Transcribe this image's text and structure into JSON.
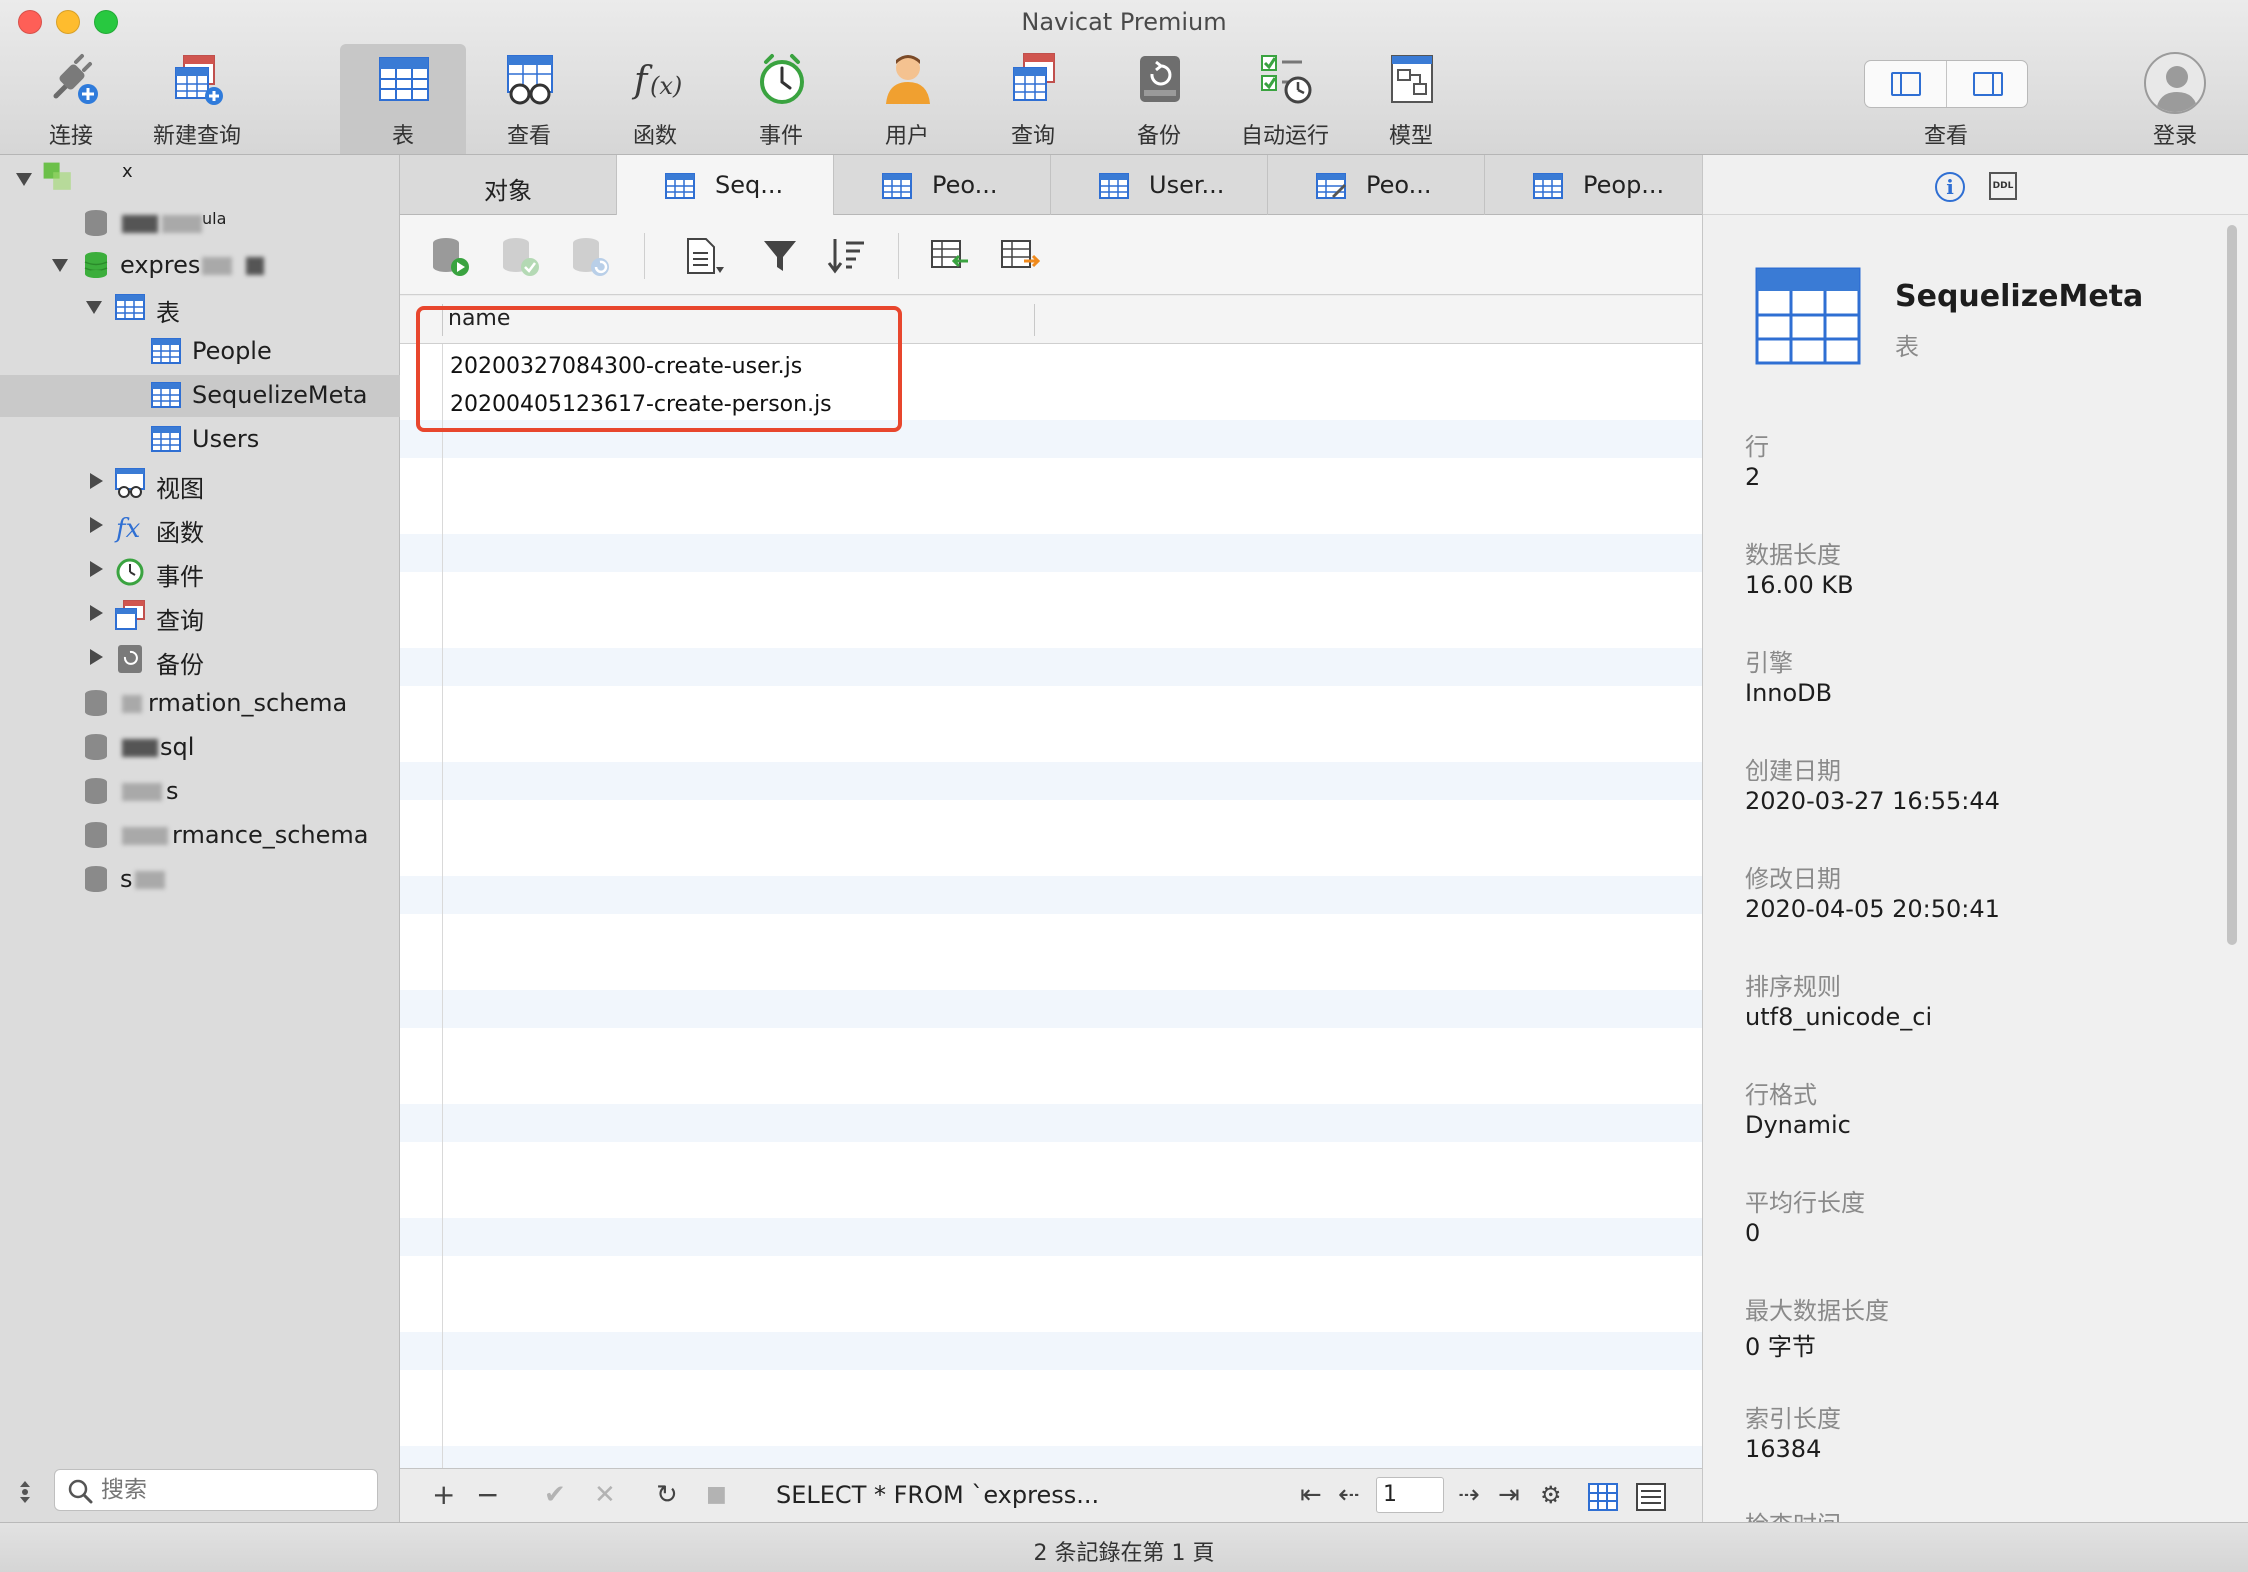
{
  "window": {
    "title": "Navicat Premium"
  },
  "toolbar": {
    "items": [
      {
        "label": "连接",
        "icon": "connection-plug-icon"
      },
      {
        "label": "新建查询",
        "icon": "new-query-icon"
      },
      {
        "label": "表",
        "icon": "table-icon",
        "active": true
      },
      {
        "label": "查看",
        "icon": "view-glasses-icon"
      },
      {
        "label": "函数",
        "icon": "function-fx-icon"
      },
      {
        "label": "事件",
        "icon": "event-clock-icon"
      },
      {
        "label": "用户",
        "icon": "user-icon"
      },
      {
        "label": "查询",
        "icon": "query-icon"
      },
      {
        "label": "备份",
        "icon": "backup-icon"
      },
      {
        "label": "自动运行",
        "icon": "automation-icon"
      },
      {
        "label": "模型",
        "icon": "model-icon"
      }
    ],
    "view_label": "查看",
    "login_label": "登录"
  },
  "sidebar": {
    "connection_suffix": "x",
    "db_first_suffix": "ula",
    "db_express": "expres",
    "tables_group": "表",
    "tables": [
      "People",
      "SequelizeMeta",
      "Users"
    ],
    "groups": [
      "视图",
      "函数",
      "事件",
      "查询",
      "备份"
    ],
    "other_dbs": [
      "rmation_schema",
      "sql",
      "s",
      "rmance_schema",
      "s"
    ],
    "search_placeholder": "搜索"
  },
  "tabs": [
    "对象",
    "Seq...",
    "Peo...",
    "User...",
    "Peo...",
    "Peop..."
  ],
  "grid": {
    "columns": [
      "name"
    ],
    "rows": [
      "20200327084300-create-user.js",
      "20200405123617-create-person.js"
    ]
  },
  "bottom_bar": {
    "add": "+",
    "remove": "−",
    "apply": "✔",
    "discard": "✕",
    "refresh": "↻",
    "stop": "■",
    "sql": "SELECT * FROM `express...",
    "first": "⇤",
    "prev": "⇠",
    "page": "1",
    "next": "⇢",
    "last": "⇥",
    "settings": "⚙"
  },
  "status": {
    "text": "2 条記錄在第 1 頁"
  },
  "info": {
    "name": "SequelizeMeta",
    "type": "表",
    "properties": [
      {
        "label": "行",
        "value": "2"
      },
      {
        "label": "数据长度",
        "value": "16.00 KB"
      },
      {
        "label": "引擎",
        "value": "InnoDB"
      },
      {
        "label": "创建日期",
        "value": "2020-03-27 16:55:44"
      },
      {
        "label": "修改日期",
        "value": "2020-04-05 20:50:41"
      },
      {
        "label": "排序规则",
        "value": "utf8_unicode_ci"
      },
      {
        "label": "行格式",
        "value": "Dynamic"
      },
      {
        "label": "平均行长度",
        "value": "0"
      },
      {
        "label": "最大数据长度",
        "value": "0 字节"
      },
      {
        "label": "索引长度",
        "value": "16384"
      },
      {
        "label": "检查时间",
        "value": ""
      }
    ],
    "ddl_badge": "DDL"
  },
  "colors": {
    "accent": "#2f6fd3",
    "highlight": "#e8462d",
    "db_green": "#3cae3c"
  }
}
